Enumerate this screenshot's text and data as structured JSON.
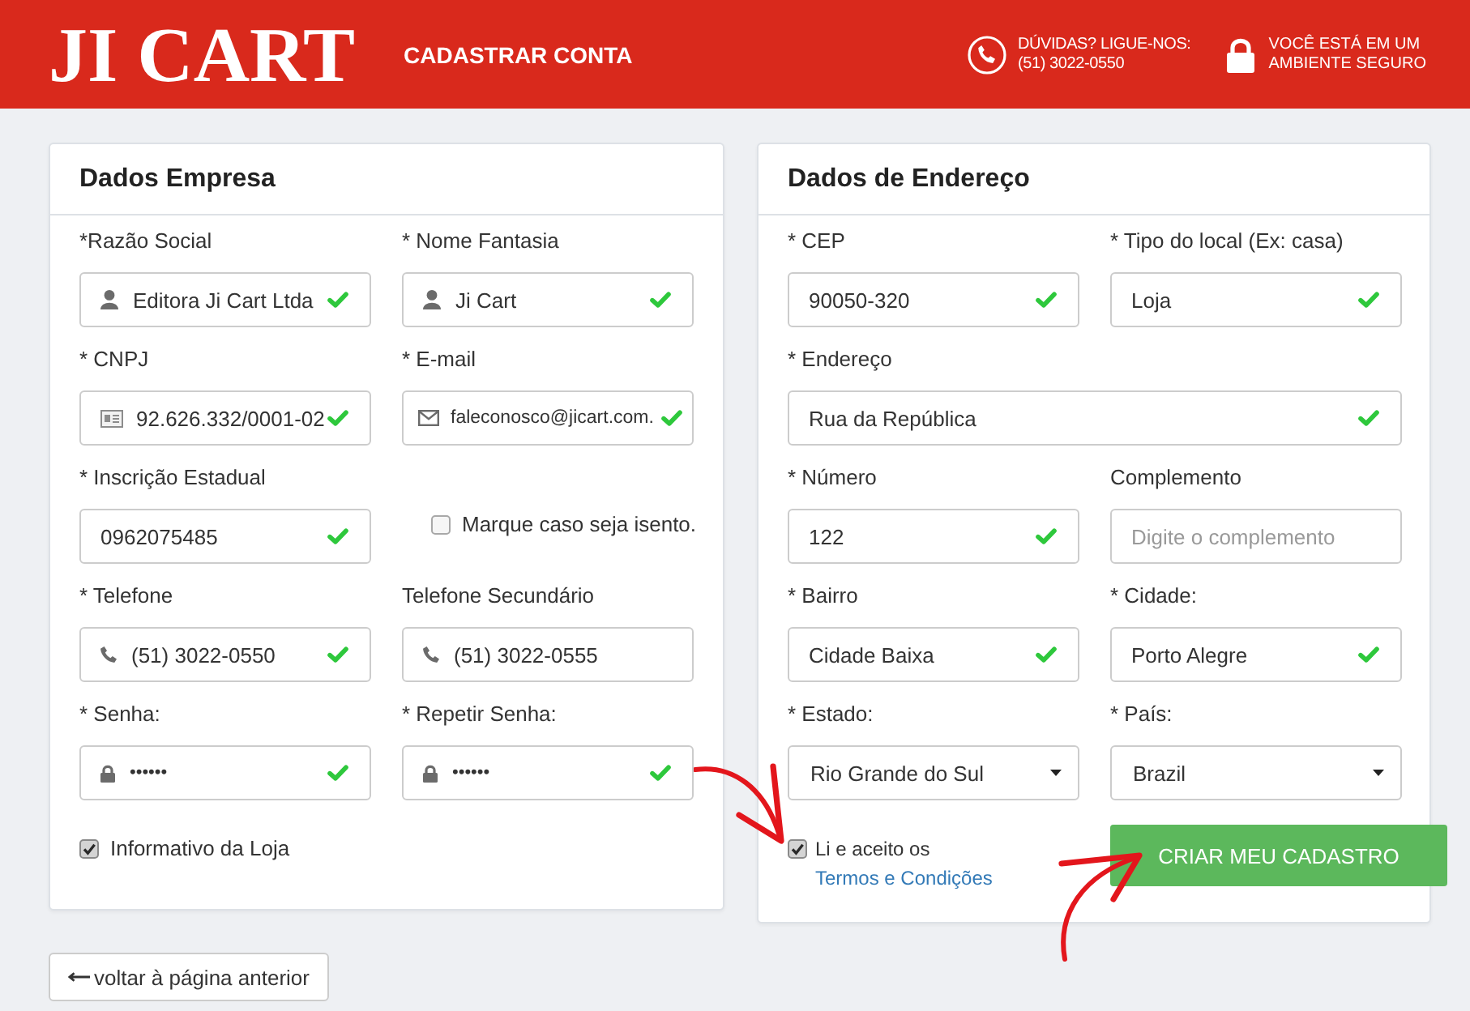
{
  "header": {
    "logo": "JI CART",
    "title": "CADASTRAR CONTA",
    "help_label": "DÚVIDAS? LIGUE-NOS:",
    "help_phone": "(51) 3022-0550",
    "security_lines": [
      "VOCÊ ESTÁ EM UM",
      "AMBIENTE SEGURO"
    ]
  },
  "company": {
    "title": "Dados Empresa",
    "rows": [
      [
        {
          "kind": "name",
          "label": "*Razão Social",
          "value": "Editora Ji Cart Ltda",
          "valid": true
        },
        {
          "kind": "name",
          "label": "* Nome Fantasia",
          "value": "Ji Cart",
          "valid": true
        }
      ],
      [
        {
          "kind": "cnpj",
          "label": "* CNPJ",
          "value": "92.626.332/0001-02",
          "valid": true
        },
        {
          "kind": "email",
          "label": "* E-mail",
          "value": "faleconosco@jicart.com.",
          "valid": true
        }
      ],
      [
        {
          "kind": "plain",
          "label": "* Inscrição Estadual",
          "value": "0962075485",
          "valid": true
        },
        {
          "kind": "checkbox",
          "label": "Marque caso seja isento.",
          "checked": false
        }
      ],
      [
        {
          "kind": "phone",
          "label": "* Telefone",
          "value": "(51) 3022-0550",
          "valid": true
        },
        {
          "kind": "phone",
          "label": "Telefone Secundário",
          "value": "(51) 3022-0555",
          "valid": false
        }
      ],
      [
        {
          "kind": "password",
          "label": "* Senha:",
          "value": "••••••",
          "valid": true
        },
        {
          "kind": "password",
          "label": "* Repetir Senha:",
          "value": "••••••",
          "valid": true
        }
      ]
    ],
    "newsletter": {
      "label": "Informativo da Loja",
      "checked": true
    }
  },
  "address": {
    "title": "Dados de Endereço",
    "rows": [
      [
        {
          "kind": "plain",
          "label": "* CEP",
          "value": "90050-320",
          "valid": true
        },
        {
          "kind": "plain",
          "label": "* Tipo do local (Ex: casa)",
          "value": "Loja",
          "valid": true
        }
      ],
      [
        {
          "kind": "plain",
          "label": "* Endereço",
          "value": "Rua da República",
          "valid": true
        }
      ],
      [
        {
          "kind": "plain",
          "label": "* Número",
          "value": "122",
          "valid": true
        },
        {
          "kind": "plain",
          "label": "Complemento",
          "placeholder": "Digite o complemento",
          "valid": false
        }
      ],
      [
        {
          "kind": "plain",
          "label": "* Bairro",
          "value": "Cidade Baixa",
          "valid": true
        },
        {
          "kind": "plain",
          "label": "* Cidade:",
          "value": "Porto Alegre",
          "valid": true
        }
      ],
      [
        {
          "kind": "select",
          "label": "* Estado:",
          "value": "Rio Grande do Sul"
        },
        {
          "kind": "select",
          "label": "* País:",
          "value": "Brazil"
        }
      ]
    ],
    "terms": {
      "checked": true,
      "text": "Li e aceito os",
      "link": "Termos e Condições"
    },
    "submit": "CRIAR MEU CADASTRO"
  },
  "back_link": "voltar à página anterior"
}
